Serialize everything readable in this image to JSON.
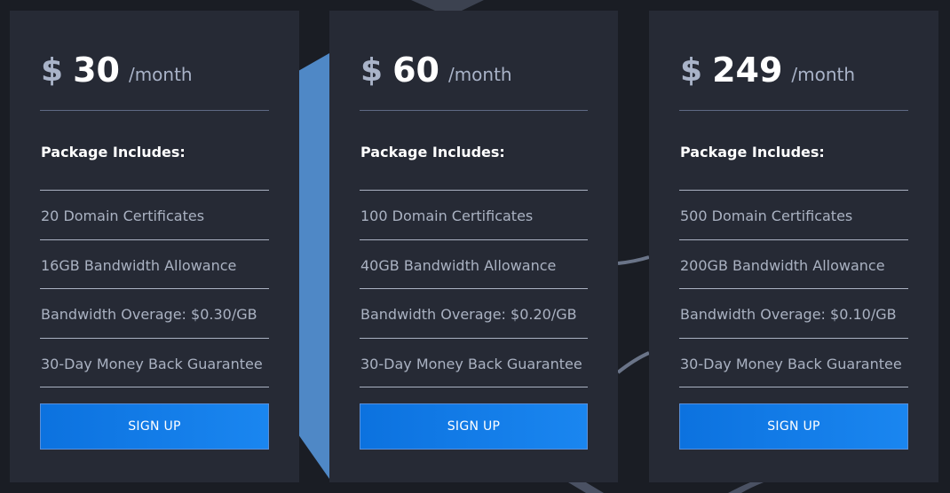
{
  "plans": [
    {
      "currency": "$",
      "amount": "30",
      "period": "/month",
      "includes_heading": "Package Includes:",
      "features": [
        "20 Domain Certificates",
        "16GB Bandwidth Allowance",
        "Bandwidth Overage: $0.30/GB",
        "30-Day Money Back Guarantee"
      ],
      "button_label": "SIGN UP"
    },
    {
      "currency": "$",
      "amount": "60",
      "period": "/month",
      "includes_heading": "Package Includes:",
      "features": [
        "100 Domain Certificates",
        "40GB Bandwidth Allowance",
        "Bandwidth Overage: $0.20/GB",
        "30-Day Money Back Guarantee"
      ],
      "button_label": "SIGN UP"
    },
    {
      "currency": "$",
      "amount": "249",
      "period": "/month",
      "includes_heading": "Package Includes:",
      "features": [
        "500 Domain Certificates",
        "200GB Bandwidth Allowance",
        "Bandwidth Overage: $0.10/GB",
        "30-Day Money Back Guarantee"
      ],
      "button_label": "SIGN UP"
    }
  ],
  "colors": {
    "background": "#1a1d24",
    "card": "#262a35",
    "accent": "#0c72df",
    "text_muted": "#aab2c2",
    "text_white": "#ffffff"
  }
}
